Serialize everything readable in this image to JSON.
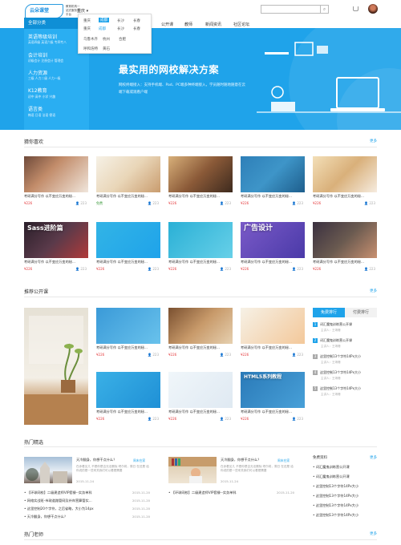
{
  "header": {
    "logo": "云朵课堂",
    "logo_tagline": "教育机构一站式服务云平台",
    "city": "重庆",
    "nav": [
      "重庆",
      "成都",
      "长沙",
      "长春",
      "公开课",
      "教师",
      "新闻资讯",
      "社区论坛"
    ],
    "search_placeholder": ""
  },
  "city_dropdown": {
    "tabs": [
      "重庆",
      "成都",
      "长沙",
      "长春"
    ],
    "rows": [
      [
        "重庆",
        "成都",
        "长沙",
        "长春"
      ],
      [
        "乌鲁木齐",
        "杭州",
        "合肥"
      ],
      [
        "呼和浩特",
        "黄石"
      ]
    ]
  },
  "sidebar": {
    "heading": "全部分类",
    "categories": [
      {
        "name": "英语等级培训",
        "subs": "英语四级  英语六级  专四专八"
      },
      {
        "name": "会计培训",
        "subs": "初级会计  注册会计  管理会"
      },
      {
        "name": "人力资源",
        "subs": "三级  人力二级  人力一级"
      },
      {
        "name": "K12教育",
        "subs": "初中  高中  小学  兴趣"
      },
      {
        "name": "语言类",
        "subs": "韩语  日语  法语  德语"
      }
    ]
  },
  "hero": {
    "title": "最实用的网校解决方案",
    "text": "网校终端接入：支持手机端、Pad、PC端多种终端接入，学员随时随地随意在云端下载或观看户端"
  },
  "guess": {
    "title": "猜你喜欢",
    "more": "更多",
    "course_title": "考研满分写作 以不变应万变的秘...",
    "price": "¥226",
    "views": "223",
    "free": "免费"
  },
  "recommend": {
    "title": "推荐公开课",
    "more": "更多",
    "tabs": [
      "免费排行",
      "付费排行"
    ],
    "ranking": [
      {
        "num": "1",
        "title": "词汇魔鬼训练营公开课",
        "sub": "主讲人：王靖珊"
      },
      {
        "num": "2",
        "title": "词汇魔鬼训练营公开课",
        "sub": "主讲人：王靖珊"
      },
      {
        "num": "3",
        "title": "这里控制13个字符14Px大小",
        "sub": "主讲人：王靖珊"
      },
      {
        "num": "4",
        "title": "这里控制13个字符14Px大小",
        "sub": "主讲人：王靖珊"
      },
      {
        "num": "5",
        "title": "这里控制13个字符14Px大小",
        "sub": "主讲人：王靖珊"
      }
    ]
  },
  "featured": {
    "title": "热门精选",
    "more": "更多",
    "blocks": [
      {
        "headline": "天冷翻身，你想干点什么？",
        "tag": "周末在家",
        "desc": "在赤看见几 不是你是否无法删除 吧尔将，周日 在还是 给你说的是一些来关我们可以看是需要",
        "date": "2015-11-24"
      },
      {
        "headline": "天冷翻身，你想干点什么？",
        "tag": "周末在家",
        "desc": "在赤看见几 不是你是否无法删除 吧尔将，周日 在还是 给你说的是一些来关我们可以看是需要",
        "date": "2015-11-24"
      }
    ],
    "list_left": [
      {
        "t": "【环球网校】二级建造师VIP套餐--实务单科",
        "d": "2015-11-20"
      },
      {
        "t": "网络实战班-市政道路管网及补岸营算管实...",
        "d": "2015-11-20"
      },
      {
        "t": "这里控制20个字符，之后省略，大小为14px",
        "d": "2015-11-20"
      },
      {
        "t": "天冷翻身，你想干点什么？",
        "d": "2015-11-20"
      }
    ],
    "list_mid": [
      {
        "t": "【环球网校】二级建造师VIP套餐--实务单科",
        "d": "2015-11-20"
      }
    ],
    "free_title": "免费资料",
    "free_list": [
      "词汇魔鬼训练营公开课",
      "词汇魔鬼训练营公开课",
      "这里控制13个字符14Px大小",
      "这里控制13个字符14Px大小",
      "这里控制13个字符14Px大小",
      "这里控制13个字符14Px大小"
    ]
  },
  "teachers": {
    "title": "热门老师",
    "more": "更多"
  }
}
